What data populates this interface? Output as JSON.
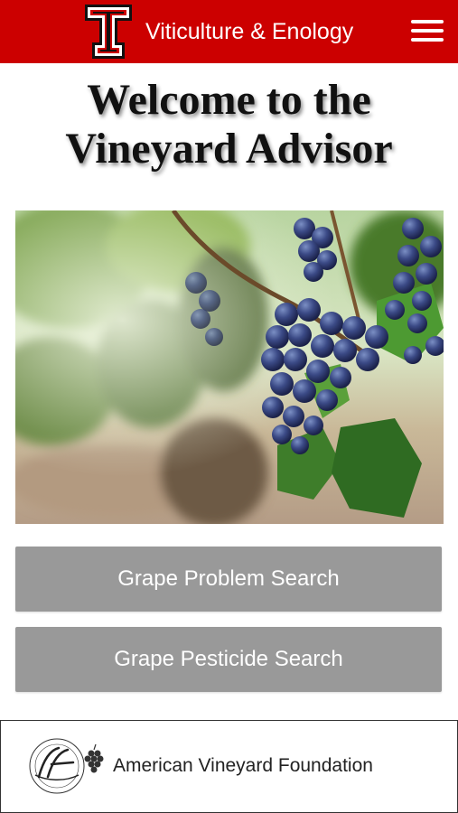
{
  "header": {
    "title": "Viticulture & Enology",
    "logo_icon": "double-t-logo-icon",
    "menu_icon": "hamburger-menu-icon",
    "bg_color": "#cc0000"
  },
  "welcome": {
    "line1": "Welcome to the",
    "line2": "Vineyard Advisor"
  },
  "hero": {
    "image": "grape-cluster-vineyard-photo"
  },
  "buttons": {
    "problem_search": "Grape Problem Search",
    "pesticide_search": "Grape Pesticide Search",
    "color": "#999999"
  },
  "footer": {
    "name": "American Vineyard Foundation",
    "logo_icon": "avf-seal-logo-icon"
  }
}
